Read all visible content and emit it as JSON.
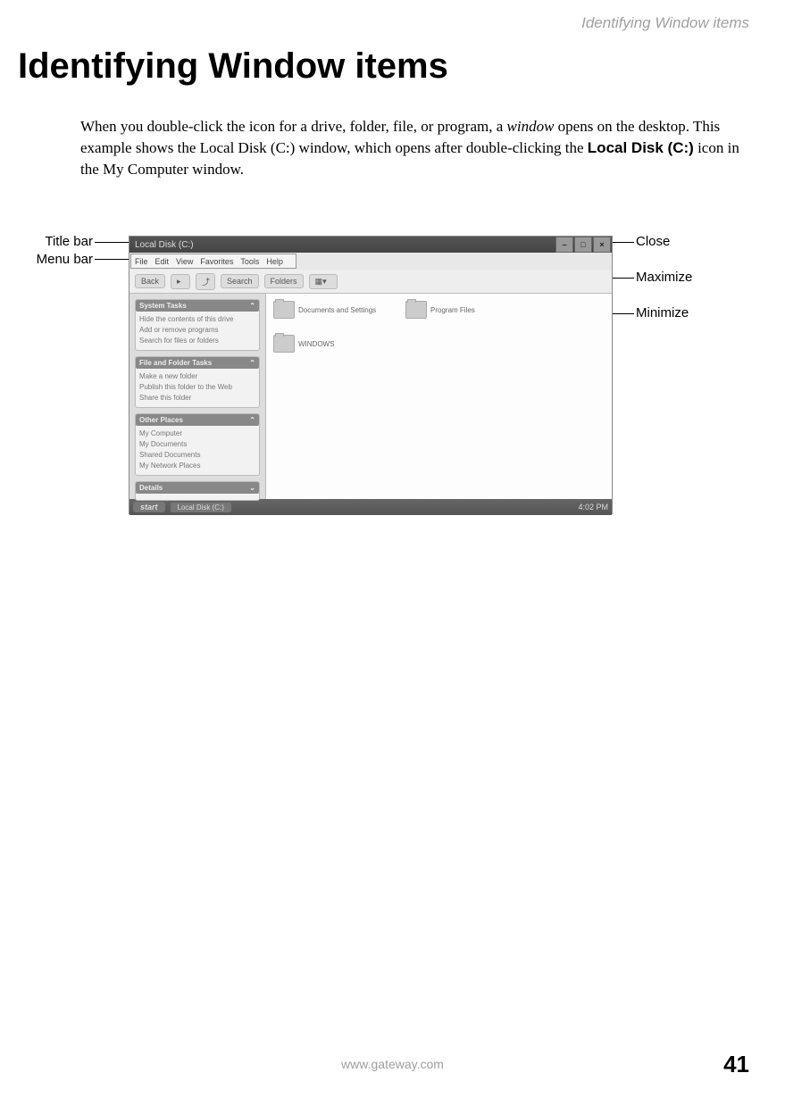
{
  "running_header": "Identifying Window items",
  "heading": "Identifying Window items",
  "paragraph": {
    "p1": "When you double-click the icon for a drive, folder, file, or program, a ",
    "window_word": "window",
    "p2": " opens on the desktop. This example shows the Local Disk (C:) window, which opens after double-clicking the ",
    "bold": "Local Disk (C:)",
    "p3": " icon in the My Computer window."
  },
  "labels": {
    "title_bar": "Title bar",
    "menu_bar": "Menu bar",
    "close": "Close",
    "maximize": "Maximize",
    "minimize": "Minimize"
  },
  "window": {
    "title": "Local Disk (C:)",
    "menu": [
      "File",
      "Edit",
      "View",
      "Favorites",
      "Tools",
      "Help"
    ],
    "toolbar": {
      "back": "Back",
      "search": "Search",
      "folders": "Folders"
    },
    "sidebar_panels": [
      {
        "title": "System Tasks",
        "items": [
          "Hide the contents of this drive",
          "Add or remove programs",
          "Search for files or folders"
        ]
      },
      {
        "title": "File and Folder Tasks",
        "items": [
          "Make a new folder",
          "Publish this folder to the Web",
          "Share this folder"
        ]
      },
      {
        "title": "Other Places",
        "items": [
          "My Computer",
          "My Documents",
          "Shared Documents",
          "My Network Places"
        ]
      },
      {
        "title": "Details",
        "items": []
      }
    ],
    "folders": [
      "Documents and Settings",
      "Program Files",
      "WINDOWS"
    ],
    "taskbar": {
      "start": "start",
      "item": "Local Disk (C:)",
      "time": "4:02 PM"
    },
    "buttons": {
      "min": "–",
      "max": "□",
      "close": "×"
    }
  },
  "footer_url": "www.gateway.com",
  "page_number": "41"
}
